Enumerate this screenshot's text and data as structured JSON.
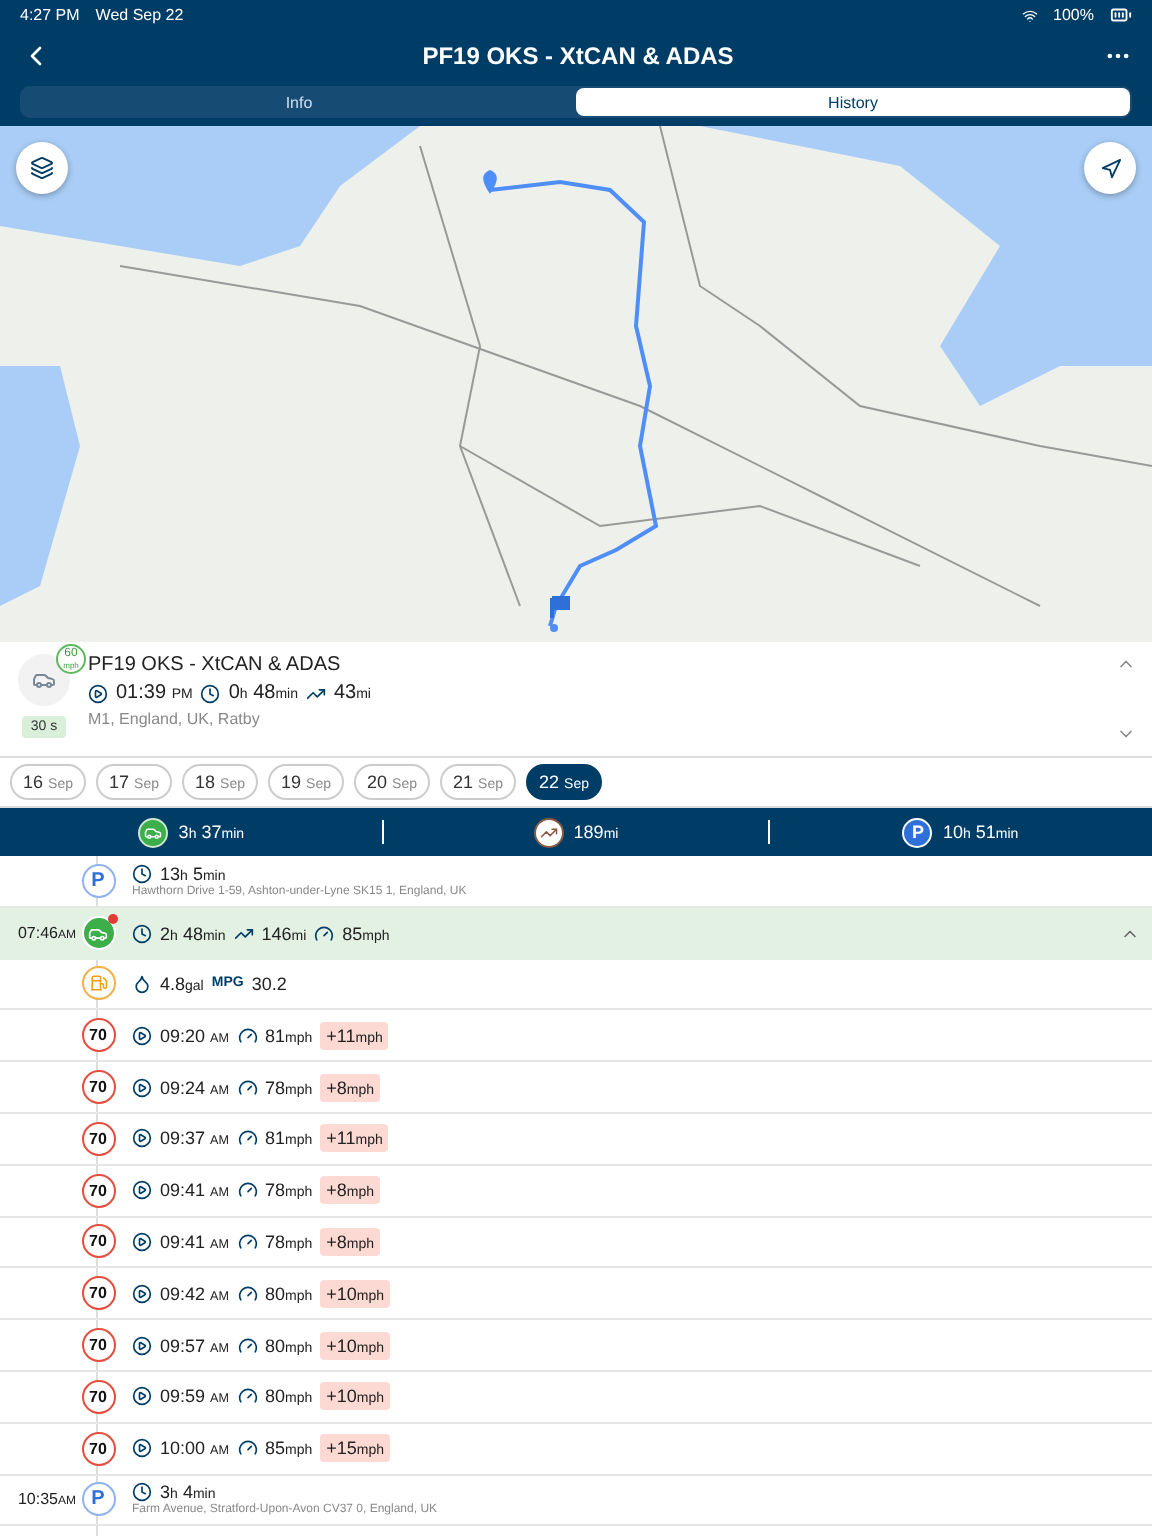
{
  "status_bar": {
    "time": "4:27 PM",
    "date": "Wed Sep 22",
    "battery": "100%"
  },
  "nav": {
    "title": "PF19 OKS - XtCAN & ADAS"
  },
  "tabs": [
    {
      "label": "Info",
      "selected": false
    },
    {
      "label": "History",
      "selected": true
    }
  ],
  "vehicle": {
    "speed_badge": "60",
    "speed_unit": "mph",
    "tag": "30 s",
    "title": "PF19 OKS - XtCAN & ADAS",
    "time": "01:39",
    "meridiem": "PM",
    "duration": [
      {
        "n": "0",
        "u": "h"
      },
      {
        "n": "48",
        "u": "min"
      }
    ],
    "distance": [
      {
        "n": "43",
        "u": "mi"
      }
    ],
    "address": "M1, England, UK, Ratby"
  },
  "dates": [
    {
      "day": "16",
      "month": "Sep",
      "selected": false
    },
    {
      "day": "17",
      "month": "Sep",
      "selected": false
    },
    {
      "day": "18",
      "month": "Sep",
      "selected": false
    },
    {
      "day": "19",
      "month": "Sep",
      "selected": false
    },
    {
      "day": "20",
      "month": "Sep",
      "selected": false
    },
    {
      "day": "21",
      "month": "Sep",
      "selected": false
    },
    {
      "day": "22",
      "month": "Sep",
      "selected": true
    }
  ],
  "summary": [
    {
      "kind": "drive",
      "value": [
        {
          "n": "3",
          "u": "h"
        },
        {
          "n": "37",
          "u": "min"
        }
      ]
    },
    {
      "kind": "distance",
      "value": [
        {
          "n": "189",
          "u": "mi"
        }
      ]
    },
    {
      "kind": "park",
      "symbol": "P",
      "value": [
        {
          "n": "10",
          "u": "h"
        },
        {
          "n": "51",
          "u": "min"
        }
      ]
    }
  ],
  "timeline": [
    {
      "kind": "parking",
      "symbol": "P",
      "duration": [
        {
          "n": "13",
          "u": "h"
        },
        {
          "n": "5",
          "u": "min"
        }
      ],
      "address": "Hawthorn Drive 1-59, Ashton-under-Lyne SK15 1, England, UK"
    },
    {
      "kind": "trip",
      "time": "07:46",
      "meridiem": "AM",
      "expanded": true,
      "alert": true,
      "duration": [
        {
          "n": "2",
          "u": "h"
        },
        {
          "n": "48",
          "u": "min"
        }
      ],
      "distance": [
        {
          "n": "146",
          "u": "mi"
        }
      ],
      "speed": [
        {
          "n": "85",
          "u": "mph"
        }
      ]
    },
    {
      "kind": "fuel",
      "volume": [
        {
          "n": "4.8",
          "u": "gal"
        }
      ],
      "mpg_label": "MPG",
      "mpg": "30.2"
    },
    {
      "kind": "speeding",
      "limit": "70",
      "time": "09:20",
      "meridiem": "AM",
      "speed": [
        {
          "n": "81",
          "u": "mph"
        }
      ],
      "over": [
        {
          "n": "+11",
          "u": "mph"
        }
      ]
    },
    {
      "kind": "speeding",
      "limit": "70",
      "time": "09:24",
      "meridiem": "AM",
      "speed": [
        {
          "n": "78",
          "u": "mph"
        }
      ],
      "over": [
        {
          "n": "+8",
          "u": "mph"
        }
      ]
    },
    {
      "kind": "speeding",
      "limit": "70",
      "time": "09:37",
      "meridiem": "AM",
      "speed": [
        {
          "n": "81",
          "u": "mph"
        }
      ],
      "over": [
        {
          "n": "+11",
          "u": "mph"
        }
      ]
    },
    {
      "kind": "speeding",
      "limit": "70",
      "time": "09:41",
      "meridiem": "AM",
      "speed": [
        {
          "n": "78",
          "u": "mph"
        }
      ],
      "over": [
        {
          "n": "+8",
          "u": "mph"
        }
      ]
    },
    {
      "kind": "speeding",
      "limit": "70",
      "time": "09:41",
      "meridiem": "AM",
      "speed": [
        {
          "n": "78",
          "u": "mph"
        }
      ],
      "over": [
        {
          "n": "+8",
          "u": "mph"
        }
      ]
    },
    {
      "kind": "speeding",
      "limit": "70",
      "time": "09:42",
      "meridiem": "AM",
      "speed": [
        {
          "n": "80",
          "u": "mph"
        }
      ],
      "over": [
        {
          "n": "+10",
          "u": "mph"
        }
      ]
    },
    {
      "kind": "speeding",
      "limit": "70",
      "time": "09:57",
      "meridiem": "AM",
      "speed": [
        {
          "n": "80",
          "u": "mph"
        }
      ],
      "over": [
        {
          "n": "+10",
          "u": "mph"
        }
      ]
    },
    {
      "kind": "speeding",
      "limit": "70",
      "time": "09:59",
      "meridiem": "AM",
      "speed": [
        {
          "n": "80",
          "u": "mph"
        }
      ],
      "over": [
        {
          "n": "+10",
          "u": "mph"
        }
      ]
    },
    {
      "kind": "speeding",
      "limit": "70",
      "time": "10:00",
      "meridiem": "AM",
      "speed": [
        {
          "n": "85",
          "u": "mph"
        }
      ],
      "over": [
        {
          "n": "+15",
          "u": "mph"
        }
      ]
    },
    {
      "kind": "parking",
      "symbol": "P",
      "time": "10:35",
      "meridiem": "AM",
      "duration": [
        {
          "n": "3",
          "u": "h"
        },
        {
          "n": "4",
          "u": "min"
        }
      ],
      "address": "Farm Avenue, Stratford-Upon-Avon CV37 0, England, UK"
    }
  ]
}
